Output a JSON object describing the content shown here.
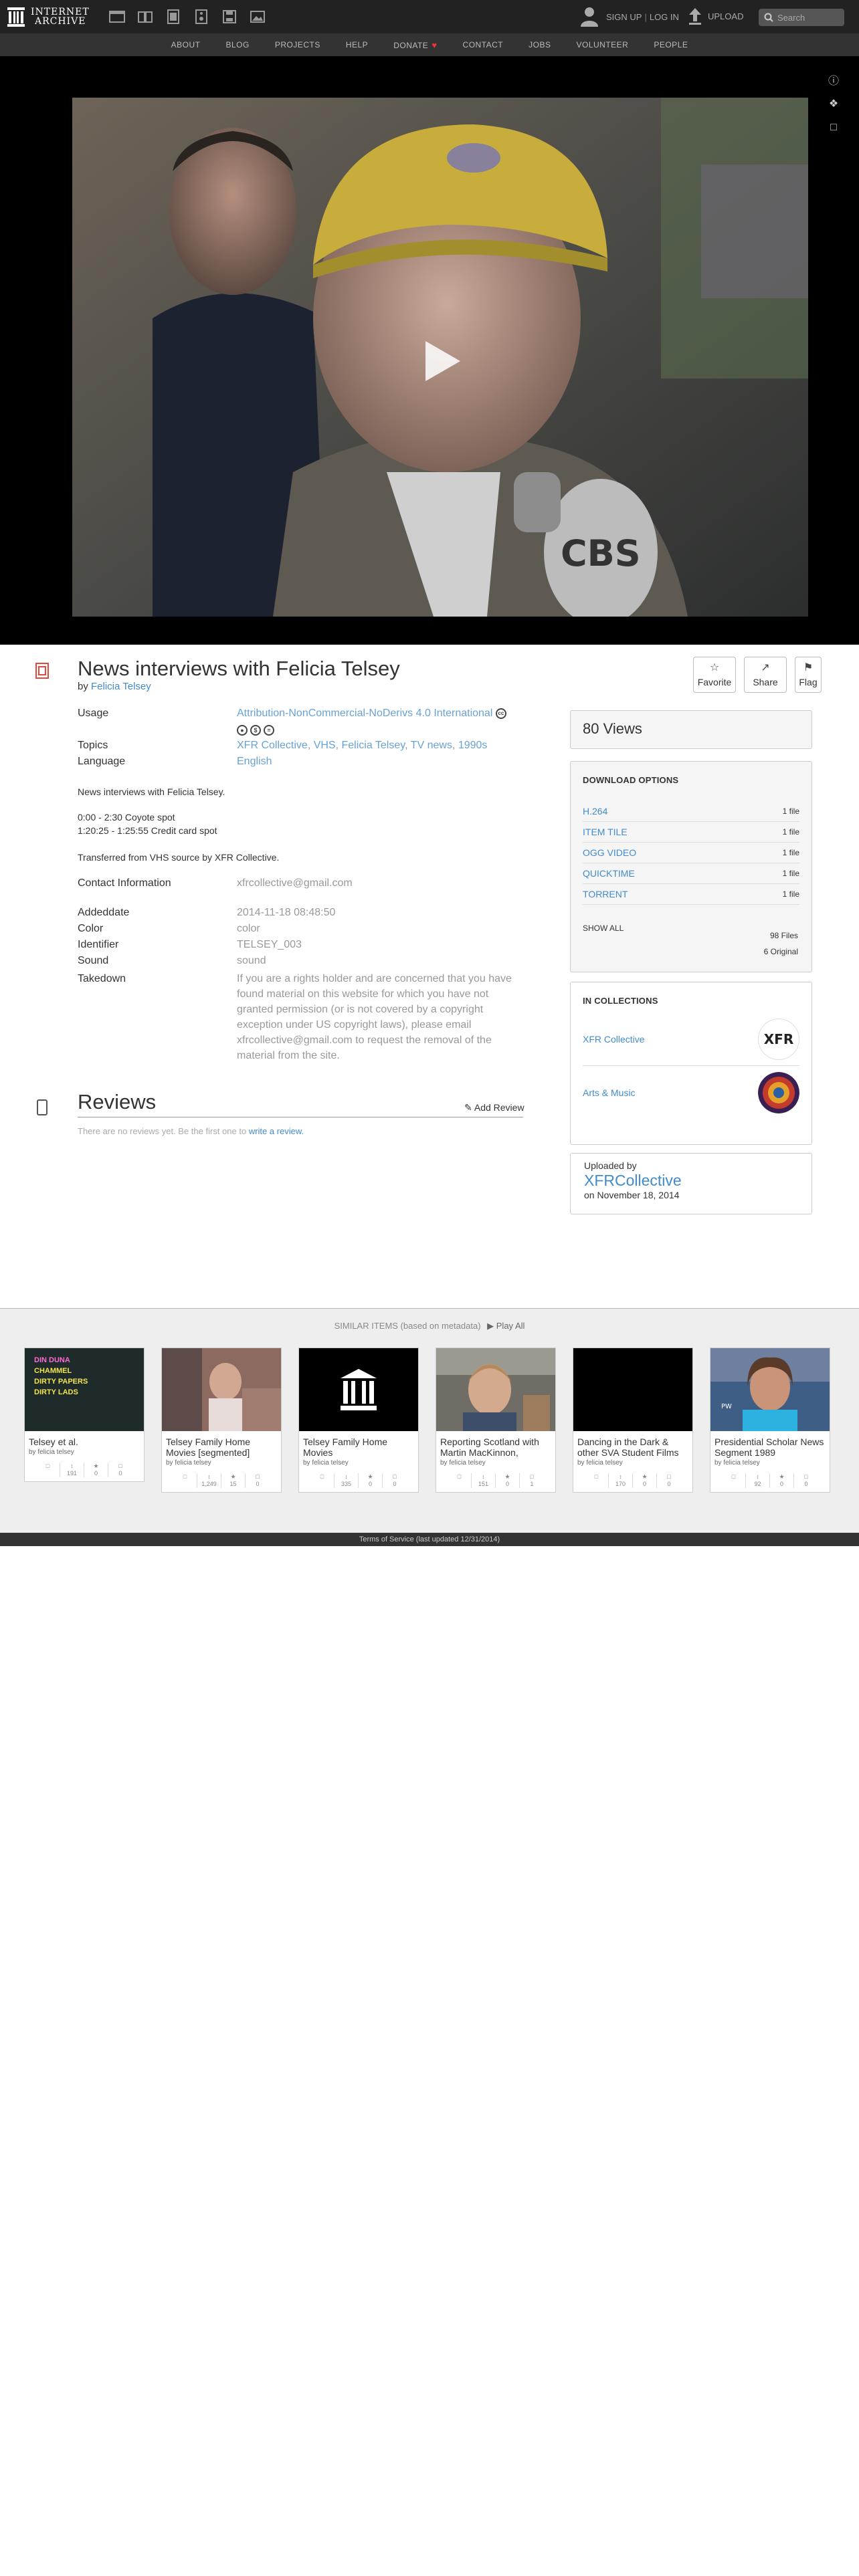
{
  "nav": {
    "logo_line1": "INTERNET",
    "logo_line2": "ARCHIVE",
    "media_icons": [
      "web-icon",
      "texts-icon",
      "video-icon",
      "audio-icon",
      "software-icon",
      "images-icon"
    ],
    "signup": "SIGN UP",
    "login": "LOG IN",
    "separator": "|",
    "upload": "UPLOAD",
    "search_placeholder": "Search",
    "links": [
      "ABOUT",
      "BLOG",
      "PROJECTS",
      "HELP",
      "DONATE",
      "CONTACT",
      "JOBS",
      "VOLUNTEER",
      "PEOPLE"
    ],
    "donate_heart_color": "#e33333"
  },
  "item": {
    "title": "News interviews with Felicia Telsey",
    "by_label": "by",
    "creator": "Felicia Telsey",
    "actions": {
      "favorite": "Favorite",
      "share": "Share",
      "flag": "Flag"
    },
    "usage_label": "Usage",
    "usage_value": "Attribution-NonCommercial-NoDerivs 4.0 International",
    "cc_icons": [
      "cc-by-icon",
      "cc-nc-icon",
      "cc-nd-icon"
    ],
    "topics_label": "Topics",
    "topics": [
      "XFR Collective",
      "VHS",
      "Felicia Telsey",
      "TV news",
      "1990s"
    ],
    "language_label": "Language",
    "language_value": "English",
    "description_line1": "News interviews with Felicia Telsey.",
    "description_line2": "0:00 - 2:30 Coyote spot",
    "description_line3": "1:20:25 - 1:25:55 Credit card spot",
    "description_line4": "Transferred from VHS source by XFR Collective.",
    "contact_label": "Contact Information",
    "contact_value": "xfrcollective@gmail.com",
    "addeddate_label": "Addeddate",
    "addeddate_value": "2014-11-18 08:48:50",
    "color_label": "Color",
    "color_value": "color",
    "identifier_label": "Identifier",
    "identifier_value": "TELSEY_003",
    "sound_label": "Sound",
    "sound_value": "sound",
    "takedown_label": "Takedown",
    "takedown_value": "If you are a rights holder and are concerned that you have found material on this website for which you have not granted permission (or is not covered by a copyright exception under US copyright laws), please email xfrcollective@gmail.com to request the removal of the material from the site."
  },
  "reviews": {
    "title": "Reviews",
    "add": "Add Review",
    "empty_text": "There are no reviews yet. Be the first one to",
    "empty_link": "write a review."
  },
  "sidebar": {
    "views": "80 Views",
    "download_head": "DOWNLOAD OPTIONS",
    "downloads": [
      {
        "format": "H.264",
        "count": "1 file"
      },
      {
        "format": "ITEM TILE",
        "count": "1 file"
      },
      {
        "format": "OGG VIDEO",
        "count": "1 file"
      },
      {
        "format": "QUICKTIME",
        "count": "1 file"
      },
      {
        "format": "TORRENT",
        "count": "1 file"
      }
    ],
    "show_all": "SHOW ALL",
    "files_total": "98 Files",
    "files_original": "6 Original",
    "collections_head": "IN COLLECTIONS",
    "collections": [
      {
        "name": "XFR Collective",
        "thumb": "XFR"
      },
      {
        "name": "Arts & Music",
        "thumb": ""
      }
    ],
    "uploaded_by_label": "Uploaded by",
    "uploader": "XFRCollective",
    "upload_date": "on November 18, 2014"
  },
  "similar": {
    "head": "SIMILAR ITEMS (based on metadata)",
    "play_all": "Play All",
    "tiles": [
      {
        "title": "Telsey et al.",
        "by": "by felicia telsey",
        "views": "191",
        "favs": "0",
        "reviews": "0"
      },
      {
        "title": "Telsey Family Home Movies [segmented]",
        "by": "by felicia telsey",
        "views": "1,249",
        "favs": "15",
        "reviews": "0"
      },
      {
        "title": "Telsey Family Home Movies",
        "by": "by felicia telsey",
        "views": "335",
        "favs": "0",
        "reviews": "0"
      },
      {
        "title": "Reporting Scotland with Martin MacKinnon,",
        "by": "by felicia telsey",
        "views": "151",
        "favs": "0",
        "reviews": "1"
      },
      {
        "title": "Dancing in the Dark & other SVA Student Films",
        "by": "by felicia telsey",
        "views": "170",
        "favs": "0",
        "reviews": "0"
      },
      {
        "title": "Presidential Scholar News Segment 1989",
        "by": "by felicia telsey",
        "views": "92",
        "favs": "0",
        "reviews": "0"
      }
    ],
    "thumb_text_lines": [
      "DIN DUNA",
      "CHAMMEL",
      "DIRTY PAPERS",
      "DIRTY LADS"
    ]
  },
  "footer": {
    "text": "Terms of Service (last updated 12/31/2014)"
  }
}
